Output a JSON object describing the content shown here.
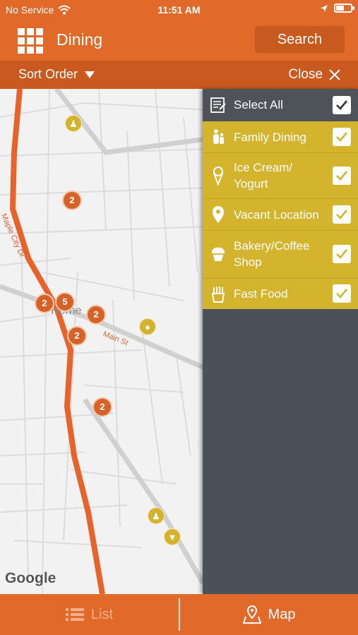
{
  "status_bar": {
    "carrier": "No Service",
    "time": "11:51 AM",
    "battery_level": 0.55
  },
  "header": {
    "title": "Dining",
    "search_label": "Search"
  },
  "sort_bar": {
    "sort_label": "Sort Order",
    "close_label": "Close"
  },
  "map": {
    "road_labels": [
      "Maple City Dr",
      "Main St"
    ],
    "town_label": "Horne",
    "attribution": "Google",
    "cluster_markers": [
      "2",
      "2",
      "5",
      "2",
      "2",
      "2"
    ],
    "route_color": "#e8622a"
  },
  "filter_panel": {
    "select_all_label": "Select All",
    "items": [
      {
        "label_line1": "Family Dining",
        "label_line2": "",
        "icon": "family-icon",
        "checked": true
      },
      {
        "label_line1": "Ice Cream/",
        "label_line2": "Yogurt",
        "icon": "ice-cream-icon",
        "checked": true
      },
      {
        "label_line1": "Vacant Location",
        "label_line2": "",
        "icon": "location-pin-icon",
        "checked": true
      },
      {
        "label_line1": "Bakery/Coffee",
        "label_line2": "Shop",
        "icon": "cupcake-icon",
        "checked": true
      },
      {
        "label_line1": "Fast Food",
        "label_line2": "",
        "icon": "fries-icon",
        "checked": true
      }
    ],
    "accent_color": "#d3b42c",
    "panel_color": "#4a5158"
  },
  "bottom_tabs": {
    "list_label": "List",
    "map_label": "Map",
    "active": "Map"
  }
}
